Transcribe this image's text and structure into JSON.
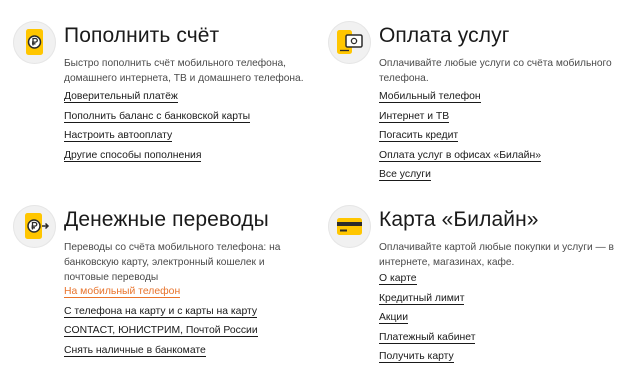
{
  "accent_color": "#ffc600",
  "active_link_color": "#e8732b",
  "sections": [
    {
      "icon": "phone-ruble-icon",
      "title": "Пополнить счёт",
      "description": "Быстро пополнить счёт мобильного телефона, домашнего интернета, ТВ и домашнего телефона.",
      "links": [
        {
          "label": "Доверительный платёж"
        },
        {
          "label": "Пополнить баланс с банковской карты"
        },
        {
          "label": "Настроить автооплату"
        },
        {
          "label": "Другие способы пополнения"
        }
      ]
    },
    {
      "icon": "phone-payment-icon",
      "title": "Оплата услуг",
      "description": "Оплачивайте любые услуги со счёта мобильного телефона.",
      "links": [
        {
          "label": "Мобильный телефон"
        },
        {
          "label": "Интернет и ТВ"
        },
        {
          "label": "Погасить кредит"
        },
        {
          "label": "Оплата услуг в офисах «Билайн»"
        },
        {
          "label": "Все услуги"
        }
      ]
    },
    {
      "icon": "phone-transfer-icon",
      "title": "Денежные переводы",
      "description": "Переводы со счёта мобильного телефона: на банковскую карту, электронный кошелек и почтовые переводы",
      "links": [
        {
          "label": "На мобильный телефон",
          "active": true
        },
        {
          "label": "С телефона на карту и с карты на карту"
        },
        {
          "label": "CONTACT, ЮНИСТРИМ, Почтой России"
        },
        {
          "label": "Снять наличные в банкомате"
        }
      ]
    },
    {
      "icon": "bank-card-icon",
      "title": "Карта «Билайн»",
      "description": "Оплачивайте картой любые покупки и услуги — в интернете, магазинах, кафе.",
      "links": [
        {
          "label": "О карте"
        },
        {
          "label": "Кредитный лимит"
        },
        {
          "label": "Акции"
        },
        {
          "label": "Платежный кабинет"
        },
        {
          "label": "Получить карту"
        }
      ]
    }
  ]
}
